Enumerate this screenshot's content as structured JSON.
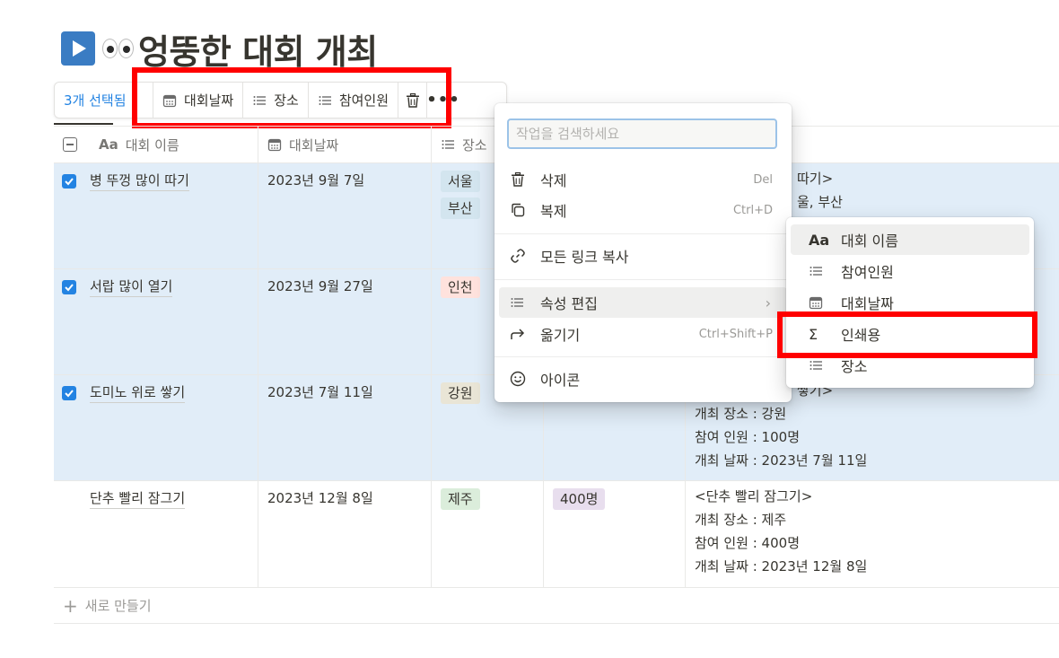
{
  "page": {
    "title": "엉뚱한 대회 개최"
  },
  "toolbar": {
    "selected_label": "3개 선택됨",
    "date_label": "대회날짜",
    "place_label": "장소",
    "people_label": "참여인원"
  },
  "table": {
    "headers": {
      "name": "대회 이름",
      "date": "대회날짜",
      "place": "장소"
    },
    "rows": [
      {
        "name": "병 뚜껑 많이 따기",
        "date": "2023년 9월 7일",
        "places": [
          "서울",
          "부산"
        ],
        "people": "",
        "summary": [
          "따기>",
          "울, 부산"
        ]
      },
      {
        "name": "서랍 많이 열기",
        "date": "2023년 9월 27일",
        "places": [
          "인천"
        ],
        "people": "",
        "summary": []
      },
      {
        "name": "도미노 위로 쌓기",
        "date": "2023년 7월 11일",
        "places": [
          "강원"
        ],
        "people": "",
        "summary": [
          "쌓기>",
          "개최 장소 : 강원",
          "참여 인원 : 100명",
          "개최 날짜 : 2023년 7월 11일"
        ]
      },
      {
        "name": "단추 빨리 잠그기",
        "date": "2023년 12월 8일",
        "places": [
          "제주"
        ],
        "people": "400명",
        "summary": [
          "<단추 빨리 잠그기>",
          "개최 장소 : 제주",
          "참여 인원 : 400명",
          "개최 날짜 : 2023년 12월 8일"
        ]
      }
    ],
    "new_row_label": "새로 만들기"
  },
  "menu": {
    "search_placeholder": "작업을 검색하세요",
    "delete_label": "삭제",
    "delete_shortcut": "Del",
    "duplicate_label": "복제",
    "duplicate_shortcut": "Ctrl+D",
    "copy_links_label": "모든 링크 복사",
    "edit_property_label": "속성 편집",
    "move_label": "옮기기",
    "move_shortcut": "Ctrl+Shift+P",
    "icon_label": "아이콘"
  },
  "submenu": {
    "items": [
      {
        "icon": "Aa",
        "label": "대회 이름"
      },
      {
        "icon": "list-icon",
        "label": "참여인원"
      },
      {
        "icon": "calendar-icon",
        "label": "대회날짜"
      },
      {
        "icon": "Σ",
        "label": "인쇄용"
      },
      {
        "icon": "list-icon",
        "label": "장소"
      }
    ]
  },
  "colors": {
    "accent": "#2383e2",
    "highlight": "#ff0000",
    "tag_seoul": "#d3e5ef",
    "tag_busan": "#d3e5ef",
    "tag_incheon": "#ffe2dd",
    "tag_gangwon": "#e9e5d6",
    "tag_jeju": "#dbeddb",
    "tag_people": "#e8deee"
  }
}
